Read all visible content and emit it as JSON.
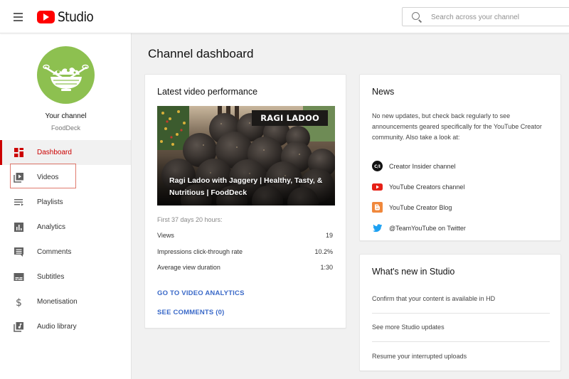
{
  "app": {
    "title": "Studio",
    "search_placeholder": "Search across your channel"
  },
  "sidebar": {
    "channel_label": "Your channel",
    "channel_name": "FoodDeck",
    "items": [
      {
        "label": "Dashboard",
        "icon": "dashboard-icon",
        "active": true
      },
      {
        "label": "Videos",
        "icon": "videos-icon",
        "active": false,
        "highlighted": true
      },
      {
        "label": "Playlists",
        "icon": "playlists-icon",
        "active": false
      },
      {
        "label": "Analytics",
        "icon": "analytics-icon",
        "active": false
      },
      {
        "label": "Comments",
        "icon": "comments-icon",
        "active": false
      },
      {
        "label": "Subtitles",
        "icon": "subtitles-icon",
        "active": false
      },
      {
        "label": "Monetisation",
        "icon": "dollar-icon",
        "active": false
      },
      {
        "label": "Audio library",
        "icon": "audio-library-icon",
        "active": false
      }
    ]
  },
  "main": {
    "page_title": "Channel dashboard",
    "latest_video": {
      "card_title": "Latest video performance",
      "thumbnail_badge": "RAGI LADOO",
      "video_title": "Ragi Ladoo with Jaggery | Healthy, Tasty, & Nutritious | FoodDeck",
      "period": "First 37 days 20 hours:",
      "metrics": [
        {
          "label": "Views",
          "value": "19"
        },
        {
          "label": "Impressions click-through rate",
          "value": "10.2%"
        },
        {
          "label": "Average view duration",
          "value": "1:30"
        }
      ],
      "analytics_link": "GO TO VIDEO ANALYTICS",
      "comments_link": "SEE COMMENTS (0)"
    },
    "news": {
      "card_title": "News",
      "body": "No new updates, but check back regularly to see announcements geared specifically for the YouTube Creator community. Also take a look at:",
      "links": [
        {
          "label": "Creator Insider channel",
          "icon": "creator-insider-icon"
        },
        {
          "label": "YouTube Creators channel",
          "icon": "youtube-icon"
        },
        {
          "label": "YouTube Creator Blog",
          "icon": "blogger-icon"
        },
        {
          "label": "@TeamYouTube on Twitter",
          "icon": "twitter-icon"
        }
      ]
    },
    "whats_new": {
      "card_title": "What's new in Studio",
      "items": [
        "Confirm that your content is available in HD",
        "See more Studio updates",
        "Resume your interrupted uploads"
      ]
    }
  },
  "colors": {
    "brand_red": "#ff0000",
    "active_red": "#cc0000",
    "link_blue": "#3a69c8",
    "avatar_green": "#8dc050"
  }
}
